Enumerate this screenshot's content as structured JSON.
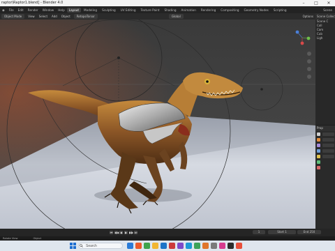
{
  "window": {
    "title": "raptor\\Raptor1.blend] - Blender 4.0",
    "controls": [
      "–",
      "□",
      "✕"
    ]
  },
  "topbar": {
    "menus": [
      "File",
      "Edit",
      "Render",
      "Window",
      "Help"
    ],
    "tabs": [
      "Layout",
      "Modeling",
      "Sculpting",
      "UV Editing",
      "Texture Paint",
      "Shading",
      "Animation",
      "Rendering",
      "Compositing",
      "Geometry Nodes",
      "Scripting"
    ],
    "active_tab": "Layout",
    "scene_label": "Scene"
  },
  "header": {
    "mode": "Object Mode",
    "menus": [
      "View",
      "Select",
      "Add",
      "Object"
    ],
    "selected_object": "RetopoTorsor",
    "transform_orientation": "Global",
    "options_label": "Options"
  },
  "outliner": {
    "title": "Scene Collection",
    "items": [
      "Scene C",
      "Coll",
      "Cam",
      "Cub",
      "Ligh"
    ]
  },
  "properties": {
    "title": "Prop",
    "tabs_colors": [
      "#cfcfcf",
      "#e08a3a",
      "#a58ad8",
      "#6f9fd8",
      "#e0c24f",
      "#5fbf7a",
      "#d86a6a"
    ]
  },
  "timeline": {
    "playback_controls": [
      "⏮",
      "◀◀",
      "◀",
      "▶",
      "▶▶",
      "⏭"
    ],
    "current_frame": "1",
    "start_label": "Start",
    "start_frame": "1",
    "end_label": "End",
    "end_frame": "250"
  },
  "statusbar": {
    "items": [
      "Rotate View",
      "Object"
    ]
  },
  "taskbar": {
    "search_placeholder": "Search",
    "app_colors": [
      "#2a7bd8",
      "#eb5b2c",
      "#3fa34d",
      "#f2b632",
      "#1d74c8",
      "#cc3a3a",
      "#7d4bc9",
      "#1e9ad6",
      "#3da35a",
      "#e0752b",
      "#7a7a7a",
      "#d63b8f",
      "#2c2c2c",
      "#e84f3b"
    ]
  },
  "colors": {
    "accent": "#4772b3",
    "viewport_bg": "#3d3d3d",
    "floor": "#dfe3ea"
  }
}
